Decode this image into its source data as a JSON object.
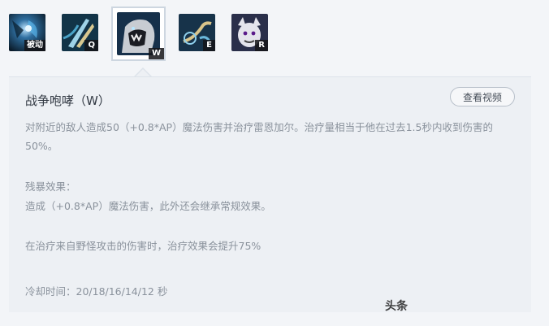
{
  "skills": [
    {
      "key": "被动",
      "icon": "passive-skill-icon"
    },
    {
      "key": "Q",
      "icon": "q-skill-icon"
    },
    {
      "key": "W",
      "icon": "w-skill-icon",
      "selected": true
    },
    {
      "key": "E",
      "icon": "e-skill-icon"
    },
    {
      "key": "R",
      "icon": "r-skill-icon"
    }
  ],
  "panel": {
    "title": "战争咆哮（W）",
    "video_button": "查看视频",
    "description": "对附近的敌人造成50（+0.8*AP）魔法伤害并治疗雷恩加尔。治疗量相当于他在过去1.5秒内收到伤害的50%。",
    "ferocity_header": "残暴效果：",
    "ferocity_text": "造成（+0.8*AP）魔法伤害，此外还会继承常规效果。",
    "monster_text": "在治疗来自野怪攻击的伤害时，治疗效果会提升75%",
    "cooldown": "冷却时间：20/18/16/14/12 秒"
  },
  "watermark": "头条",
  "colors": {
    "background": "#f3f5f8",
    "panel": "#edf0f4",
    "text_muted": "#8a929c",
    "title": "#333a44"
  }
}
